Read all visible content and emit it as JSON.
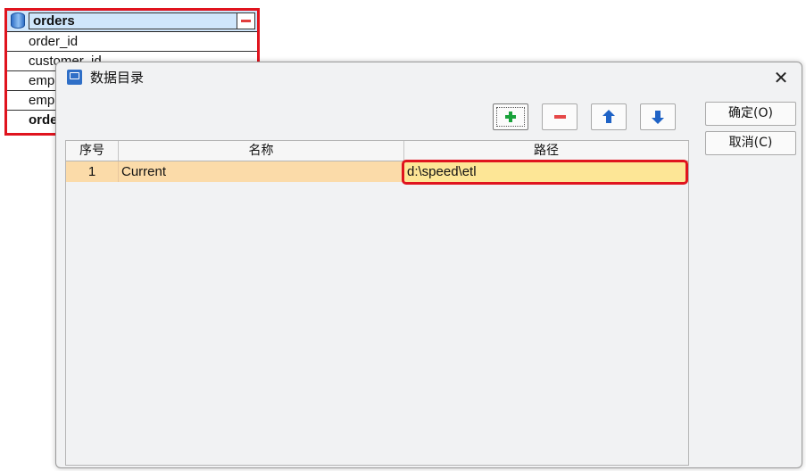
{
  "background_table": {
    "title": "orders",
    "rows": [
      "order_id",
      "customer_id",
      "emp",
      "emp",
      "orde"
    ]
  },
  "dialog": {
    "title": "数据目录",
    "close_glyph": "✕",
    "toolbar": {
      "add_icon": "plus-icon",
      "remove_icon": "minus-icon",
      "up_icon": "arrow-up-icon",
      "down_icon": "arrow-down-icon"
    },
    "ok_label": "确定(O)",
    "cancel_label": "取消(C)",
    "grid": {
      "columns": [
        "序号",
        "名称",
        "路径"
      ],
      "rows": [
        {
          "index": "1",
          "name": "Current",
          "path": "d:\\speed\\etl"
        }
      ]
    }
  },
  "colors": {
    "highlight_border": "#e0141e",
    "row_selected": "#fbdba9",
    "path_cell": "#fde696",
    "add_icon": "#18a13a",
    "remove_icon": "#e54848",
    "arrow_icon": "#1f63c6"
  }
}
